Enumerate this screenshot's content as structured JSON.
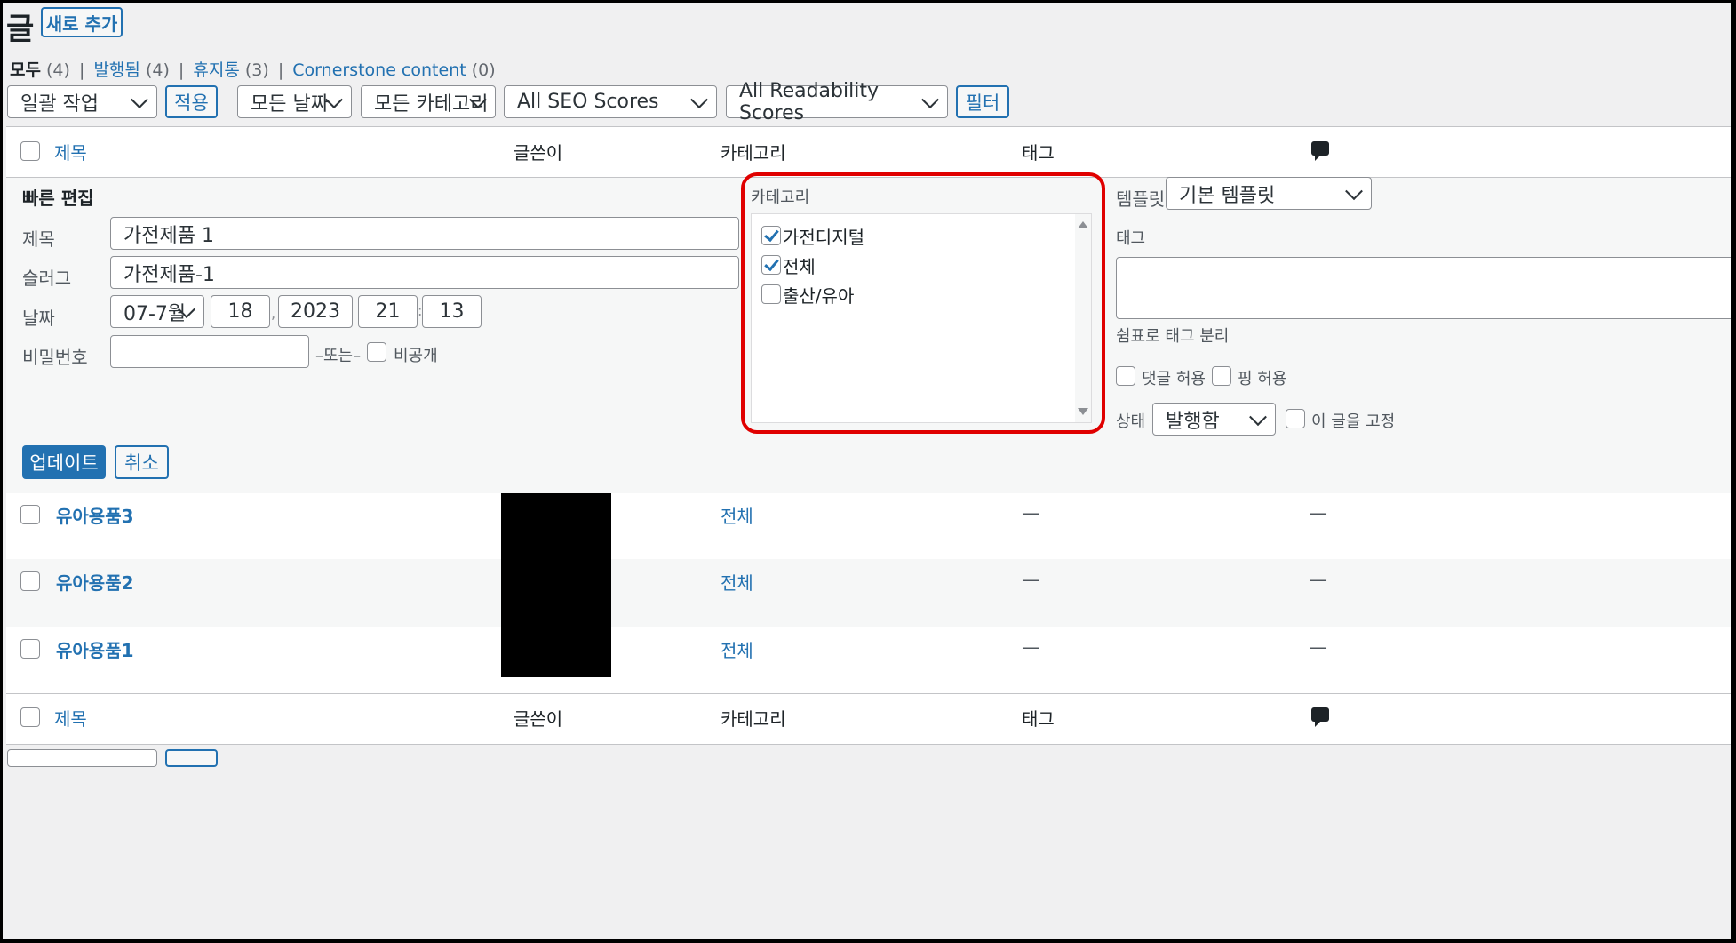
{
  "page": {
    "title": "글",
    "add_new": "새로 추가"
  },
  "subsubsub": {
    "items": [
      {
        "label": "모두",
        "count": "(4)"
      },
      {
        "label": "발행됨",
        "count": "(4)"
      },
      {
        "label": "휴지통",
        "count": "(3)"
      },
      {
        "label": "Cornerstone content",
        "count": "(0)"
      }
    ],
    "separator": "|"
  },
  "filters": {
    "bulk_action": "일괄 작업",
    "apply": "적용",
    "dates": "모든 날짜",
    "categories": "모든 카테고리",
    "seo": "All SEO Scores",
    "readability": "All Readability Scores",
    "filter": "필터"
  },
  "table": {
    "columns": {
      "title": "제목",
      "author": "글쓴이",
      "category": "카테고리",
      "tags": "태그"
    },
    "rows": [
      {
        "title": "유아용품3",
        "category": "전체",
        "tags": "—",
        "comments": "—"
      },
      {
        "title": "유아용품2",
        "category": "전체",
        "tags": "—",
        "comments": "—"
      },
      {
        "title": "유아용품1",
        "category": "전체",
        "tags": "—",
        "comments": "—"
      }
    ]
  },
  "quick_edit": {
    "heading": "빠른 편집",
    "title_label": "제목",
    "title_value": "가전제품 1",
    "slug_label": "슬러그",
    "slug_value": "가전제품-1",
    "date_label": "날짜",
    "month": "07-7월",
    "day": "18",
    "year": "2023",
    "hour": "21",
    "minute": "13",
    "date_sep": ",",
    "time_sep": ":",
    "password_label": "비밀번호",
    "or_text": "–또는–",
    "private_label": "비공개",
    "category_heading": "카테고리",
    "categories": [
      {
        "label": "가전디지털",
        "checked": true
      },
      {
        "label": "전체",
        "checked": true
      },
      {
        "label": "출산/유아",
        "checked": false
      }
    ],
    "template_label": "템플릿",
    "template_value": "기본 템플릿",
    "tags_label": "태그",
    "tags_hint": "쉼표로 태그 분리",
    "allow_comments": "댓글 허용",
    "allow_pings": "핑 허용",
    "status_label": "상태",
    "status_value": "발행함",
    "sticky_label": "이 글을 고정",
    "update": "업데이트",
    "cancel": "취소"
  },
  "colors": {
    "link": "#2271b1",
    "highlight": "#e00000",
    "background": "#f0f0f1"
  }
}
